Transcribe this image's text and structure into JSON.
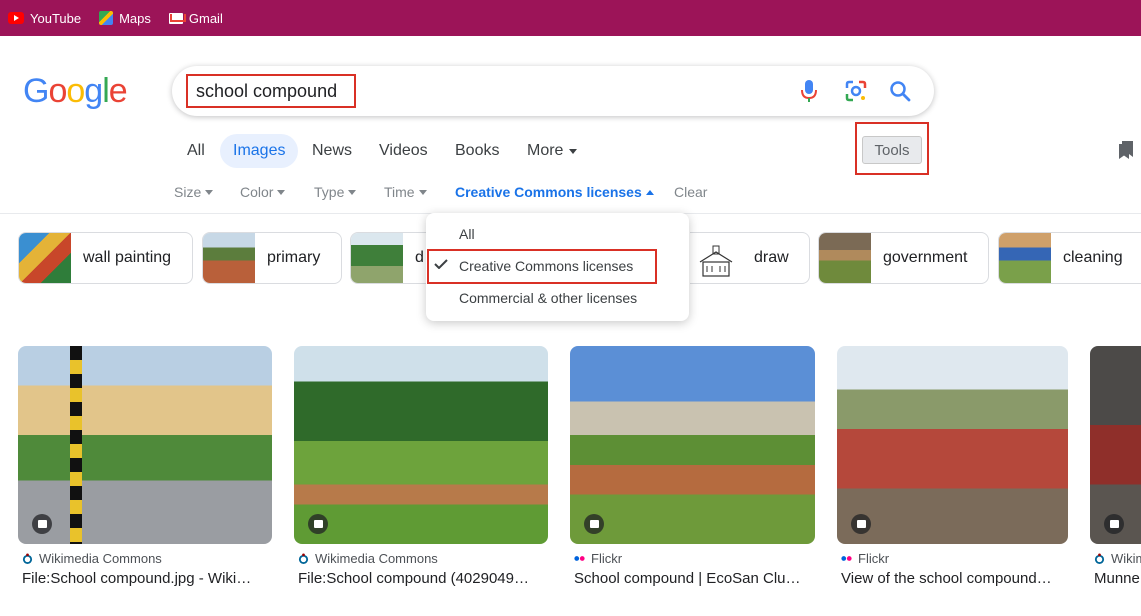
{
  "bookmarks": [
    {
      "label": "YouTube",
      "icon": "youtube-icon"
    },
    {
      "label": "Maps",
      "icon": "maps-icon"
    },
    {
      "label": "Gmail",
      "icon": "gmail-icon"
    }
  ],
  "logo": {
    "text": "Google",
    "colors": [
      "#4285f4",
      "#ea4335",
      "#fbbc05",
      "#4285f4",
      "#34a853",
      "#ea4335"
    ]
  },
  "search": {
    "query": "school compound",
    "highlight_color": "#d93025"
  },
  "tabs": [
    {
      "label": "All",
      "active": false
    },
    {
      "label": "Images",
      "active": true
    },
    {
      "label": "News",
      "active": false
    },
    {
      "label": "Videos",
      "active": false
    },
    {
      "label": "Books",
      "active": false
    },
    {
      "label": "More",
      "active": false
    }
  ],
  "tools": {
    "label": "Tools"
  },
  "filters": [
    {
      "label": "Size"
    },
    {
      "label": "Color"
    },
    {
      "label": "Type"
    },
    {
      "label": "Time"
    },
    {
      "label": "Creative Commons licenses",
      "active": true
    },
    {
      "label": "Clear"
    }
  ],
  "chips": [
    {
      "label": "wall painting"
    },
    {
      "label": "primary"
    },
    {
      "label": "d"
    },
    {
      "label": "draw"
    },
    {
      "label": "government"
    },
    {
      "label": "cleaning"
    }
  ],
  "license_menu": {
    "items": [
      {
        "label": "All",
        "checked": false
      },
      {
        "label": "Creative Commons licenses",
        "checked": true
      },
      {
        "label": "Commercial & other licenses",
        "checked": false
      }
    ]
  },
  "results": [
    {
      "source": "Wikimedia Commons",
      "title": "File:School compound.jpg - Wiki…"
    },
    {
      "source": "Wikimedia Commons",
      "title": "File:School compound (4029049…"
    },
    {
      "source": "Flickr",
      "title": "School compound | EcoSan Clu…"
    },
    {
      "source": "Flickr",
      "title": "View of the school compound…"
    },
    {
      "source": "Wikim",
      "title": "Munne"
    }
  ],
  "colors": {
    "bookmark_bar": "#9c1458",
    "accent": "#1a73e8",
    "highlight": "#d93025"
  }
}
